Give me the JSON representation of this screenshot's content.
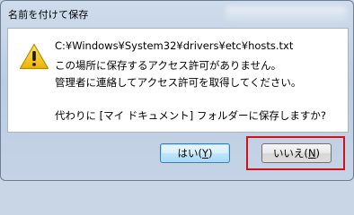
{
  "window": {
    "title": "名前を付けて保存"
  },
  "dialog": {
    "path": "C:¥Windows¥System32¥drivers¥etc¥hosts.txt",
    "line1": "この場所に保存するアクセス許可がありません。",
    "line2": "管理者に連絡してアクセス許可を取得してください。",
    "question": "代わりに [マイ ドキュメント] フォルダーに保存しますか?",
    "icon": "warning-icon"
  },
  "buttons": {
    "yes": {
      "label": "はい(",
      "key": "Y",
      "suffix": ")"
    },
    "no": {
      "label": "いいえ(",
      "key": "N",
      "suffix": ")"
    }
  },
  "colors": {
    "highlight": "#d0121b",
    "warning_yellow": "#f2c21b"
  }
}
